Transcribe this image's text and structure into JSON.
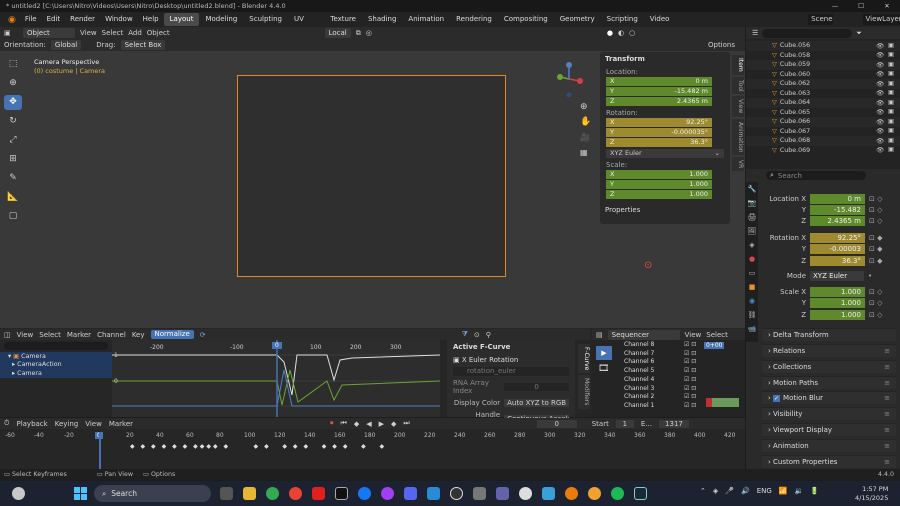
{
  "titlebar": {
    "title": "* untitled2 [C:\\Users\\Nitro\\Videos\\Users\\Nitro\\Desktop\\untitled2.blend] - Blender 4.4.0",
    "controls": [
      "—",
      "☐",
      "✕"
    ]
  },
  "menu": {
    "items": [
      "File",
      "Edit",
      "Render",
      "Window",
      "Help"
    ],
    "workspaces": [
      "Layout",
      "Modeling",
      "Sculpting",
      "UV Editing",
      "Texture Paint",
      "Shading",
      "Animation",
      "Rendering",
      "Compositing",
      "Geometry Nodes",
      "Scripting",
      "Video Editing"
    ],
    "scene": "Scene",
    "view_layer": "ViewLayer"
  },
  "header3d": {
    "mode": "Object Mode",
    "items": [
      "View",
      "Select",
      "Add",
      "Object"
    ],
    "transform": "Local",
    "options": "Options"
  },
  "header3d2": {
    "orientation_label": "Orientation:",
    "orientation": "Global",
    "drag_label": "Drag:",
    "drag": "Select Box"
  },
  "viewport": {
    "title": "Camera Perspective",
    "subtitle": "(0) costume | Camera"
  },
  "npanel": {
    "transform": "Transform",
    "location": "Location:",
    "lx": "0 m",
    "ly": "-15.482 m",
    "lz": "2.4365 m",
    "rotation": "Rotation:",
    "rx": "92.25°",
    "ry": "-0.000035°",
    "rz": "36.3°",
    "euler": "XYZ Euler",
    "scale": "Scale:",
    "sx": "1.000",
    "sy": "1.000",
    "sz": "1.000",
    "properties": "Properties",
    "tabs": [
      "Item",
      "Tool",
      "View",
      "Animation",
      "VR"
    ],
    "axis_x": "X",
    "axis_y": "Y",
    "axis_z": "Z"
  },
  "outliner": {
    "search": "Search",
    "rows": [
      "Cube.056",
      "Cube.058",
      "Cube.059",
      "Cube.060",
      "Cube.062",
      "Cube.063",
      "Cube.064",
      "Cube.065",
      "Cube.066",
      "Cube.067",
      "Cube.068",
      "Cube.069"
    ]
  },
  "props": {
    "search": "Search",
    "location_x_label": "Location X",
    "location_x": "0 m",
    "y_label": "Y",
    "location_y": "-15.482",
    "z_label": "Z",
    "location_z": "2.4365 m",
    "rotation_x_label": "Rotation X",
    "rotation_x": "92.25°",
    "rotation_y": "-0.00003",
    "rotation_z": "36.3°",
    "mode_label": "Mode",
    "mode": "XYZ Euler",
    "scale_x_label": "Scale X",
    "scale_x": "1.000",
    "scale_y": "1.000",
    "scale_z": "1.000",
    "sections": [
      "Delta Transform",
      "Relations",
      "Collections",
      "Motion Paths",
      "Motion Blur",
      "Visibility",
      "Viewport Display",
      "Animation",
      "Custom Properties"
    ]
  },
  "graph": {
    "header": [
      "View",
      "Select",
      "Marker",
      "Channel",
      "Key"
    ],
    "normalize": "Normalize",
    "ticks": [
      "-200",
      "-100",
      "0",
      "100",
      "200",
      "300"
    ],
    "channels": [
      "Camera",
      "CameraAction",
      "Camera"
    ],
    "playhead": "0"
  },
  "fcurve": {
    "title": "Active F-Curve",
    "channel": "X Euler Rotation",
    "path": "rotation_euler",
    "rna_label": "RNA Array Index",
    "rna": "0",
    "color_label": "Display Color",
    "color": "Auto XYZ to RGB",
    "smooth_label": "Handle Smoot...",
    "smooth": "Continuous Acceler...",
    "tabs": [
      "F-Curve",
      "Modifiers"
    ]
  },
  "sequencer": {
    "mode": "Sequencer",
    "items": [
      "View",
      "Select"
    ],
    "channels": [
      "Channel 8",
      "Channel 7",
      "Channel 6",
      "Channel 5",
      "Channel 4",
      "Channel 3",
      "Channel 2",
      "Channel 1"
    ],
    "time": "0+00"
  },
  "timeline": {
    "header": [
      "Playback",
      "Keying",
      "View",
      "Marker"
    ],
    "frame": "0",
    "start_label": "Start",
    "start": "1",
    "end_label": "E...",
    "end": "1317",
    "ticks": [
      "-60",
      "-40",
      "-20",
      "0",
      "20",
      "40",
      "60",
      "80",
      "100",
      "120",
      "140",
      "160",
      "180",
      "200",
      "220",
      "240",
      "260",
      "280",
      "300",
      "320",
      "340",
      "360",
      "380",
      "400",
      "420"
    ]
  },
  "status": {
    "items": [
      "Select Keyframes",
      "Pan View",
      "Options"
    ],
    "version": "4.4.0"
  },
  "taskbar": {
    "search": "Search",
    "lang": "ENG",
    "time": "1:57 PM",
    "date": "4/15/2025"
  }
}
